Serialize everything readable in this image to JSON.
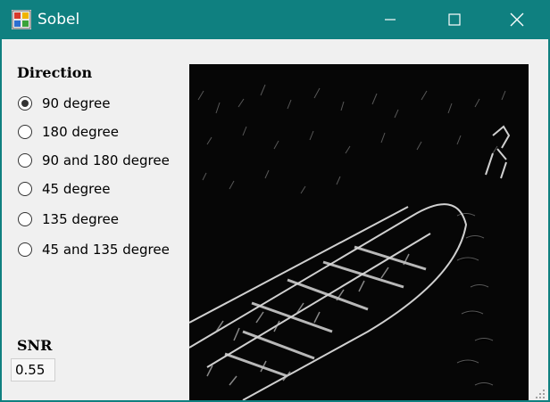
{
  "window": {
    "title": "Sobel"
  },
  "direction": {
    "label": "Direction",
    "options": [
      {
        "label": "90 degree",
        "selected": true
      },
      {
        "label": "180 degree",
        "selected": false
      },
      {
        "label": "90 and 180 degree",
        "selected": false
      },
      {
        "label": "45 degree",
        "selected": false
      },
      {
        "label": "135 degree",
        "selected": false
      },
      {
        "label": "45 and 135 degree",
        "selected": false
      }
    ]
  },
  "snr": {
    "label": "SNR",
    "value": "0.55"
  },
  "colors": {
    "titlebar": "#0f8080",
    "client": "#f0f0f0",
    "image_bg": "#060606"
  },
  "icons": [
    "app-icon",
    "minimize-icon",
    "maximize-icon",
    "close-icon",
    "size-grip-icon"
  ]
}
